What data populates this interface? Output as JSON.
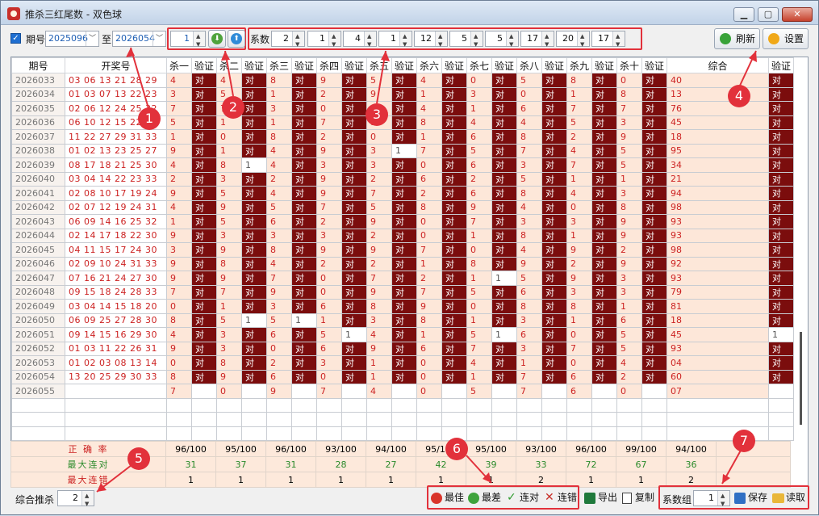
{
  "window": {
    "title": "推杀三红尾数 - 双色球"
  },
  "toolbar": {
    "period_label": "期号",
    "from_value": "2025096",
    "to_label": "至",
    "to_value": "2026054",
    "step_value": "1",
    "coef_label": "系数",
    "coefficients": [
      "2",
      "1",
      "4",
      "1",
      "12",
      "5",
      "5",
      "17",
      "20",
      "17"
    ],
    "refresh_label": "刷新",
    "settings_label": "设置"
  },
  "columns": [
    "期号",
    "开奖号",
    "杀一",
    "验证",
    "杀二",
    "验证",
    "杀三",
    "验证",
    "杀四",
    "验证",
    "杀五",
    "验证",
    "杀六",
    "验证",
    "杀七",
    "验证",
    "杀八",
    "验证",
    "杀九",
    "验证",
    "杀十",
    "验证",
    "综合",
    "验证"
  ],
  "rows": [
    {
      "period": "2026033",
      "numbers": "03 06 13 21 28 29",
      "kills": [
        "4",
        "4",
        "8",
        "9",
        "5",
        "4",
        "0",
        "5",
        "8",
        "0"
      ],
      "checks": [
        "对",
        "对",
        "对",
        "对",
        "对",
        "对",
        "对",
        "对",
        "对",
        "对"
      ],
      "combined": "40",
      "check": "对"
    },
    {
      "period": "2026034",
      "numbers": "01 03 07 13 22 23",
      "kills": [
        "3",
        "5",
        "1",
        "2",
        "9",
        "1",
        "3",
        "0",
        "1",
        "8"
      ],
      "checks": [
        "对",
        "对",
        "对",
        "对",
        "对",
        "对",
        "对",
        "对",
        "对",
        "对"
      ],
      "combined": "13",
      "check": "对"
    },
    {
      "period": "2026035",
      "numbers": "02 06 12 24 25 32",
      "kills": [
        "7",
        "7",
        "3",
        "0",
        "1",
        "4",
        "1",
        "6",
        "7",
        "7"
      ],
      "checks": [
        "对",
        "对",
        "对",
        "对",
        "对",
        "对",
        "对",
        "对",
        "对",
        "对"
      ],
      "combined": "76",
      "check": "对"
    },
    {
      "period": "2026036",
      "numbers": "06 10 12 15 22 30",
      "kills": [
        "5",
        "1",
        "1",
        "7",
        "1",
        "8",
        "4",
        "4",
        "5",
        "3"
      ],
      "checks": [
        "对",
        "对",
        "对",
        "对",
        "对",
        "对",
        "对",
        "对",
        "对",
        "对"
      ],
      "combined": "45",
      "check": "对"
    },
    {
      "period": "2026037",
      "numbers": "11 22 27 29 31 33",
      "kills": [
        "1",
        "0",
        "8",
        "2",
        "0",
        "1",
        "6",
        "8",
        "2",
        "9"
      ],
      "checks": [
        "对",
        "对",
        "对",
        "对",
        "对",
        "对",
        "对",
        "对",
        "对",
        "对"
      ],
      "combined": "18",
      "check": "对"
    },
    {
      "period": "2026038",
      "numbers": "01 02 13 23 25 27",
      "kills": [
        "9",
        "1",
        "4",
        "9",
        "3",
        "7",
        "5",
        "7",
        "4",
        "5"
      ],
      "checks": [
        "对",
        "对",
        "对",
        "对",
        "1",
        "对",
        "对",
        "对",
        "对",
        "对"
      ],
      "combined": "95",
      "check": "对"
    },
    {
      "period": "2026039",
      "numbers": "08 17 18 21 25 30",
      "kills": [
        "4",
        "8",
        "4",
        "3",
        "3",
        "0",
        "6",
        "3",
        "7",
        "5"
      ],
      "checks": [
        "对",
        "1",
        "对",
        "对",
        "对",
        "对",
        "对",
        "对",
        "对",
        "对"
      ],
      "combined": "34",
      "check": "对"
    },
    {
      "period": "2026040",
      "numbers": "03 04 14 22 23 33",
      "kills": [
        "2",
        "3",
        "2",
        "9",
        "2",
        "6",
        "2",
        "5",
        "1",
        "1"
      ],
      "checks": [
        "对",
        "对",
        "对",
        "对",
        "对",
        "对",
        "对",
        "对",
        "对",
        "对"
      ],
      "combined": "21",
      "check": "对"
    },
    {
      "period": "2026041",
      "numbers": "02 08 10 17 19 24",
      "kills": [
        "9",
        "5",
        "4",
        "9",
        "7",
        "2",
        "6",
        "8",
        "4",
        "3"
      ],
      "checks": [
        "对",
        "对",
        "对",
        "对",
        "对",
        "对",
        "对",
        "对",
        "对",
        "对"
      ],
      "combined": "94",
      "check": "对"
    },
    {
      "period": "2026042",
      "numbers": "02 07 12 19 24 31",
      "kills": [
        "4",
        "9",
        "5",
        "7",
        "5",
        "8",
        "9",
        "4",
        "0",
        "8"
      ],
      "checks": [
        "对",
        "对",
        "对",
        "对",
        "对",
        "对",
        "对",
        "对",
        "对",
        "对"
      ],
      "combined": "98",
      "check": "对"
    },
    {
      "period": "2026043",
      "numbers": "06 09 14 16 25 32",
      "kills": [
        "1",
        "5",
        "6",
        "2",
        "9",
        "0",
        "7",
        "3",
        "3",
        "9"
      ],
      "checks": [
        "对",
        "对",
        "对",
        "对",
        "对",
        "对",
        "对",
        "对",
        "对",
        "对"
      ],
      "combined": "93",
      "check": "对"
    },
    {
      "period": "2026044",
      "numbers": "02 14 17 18 22 30",
      "kills": [
        "9",
        "3",
        "3",
        "3",
        "2",
        "0",
        "1",
        "8",
        "1",
        "9"
      ],
      "checks": [
        "对",
        "对",
        "对",
        "对",
        "对",
        "对",
        "对",
        "对",
        "对",
        "对"
      ],
      "combined": "93",
      "check": "对"
    },
    {
      "period": "2026045",
      "numbers": "04 11 15 17 24 30",
      "kills": [
        "3",
        "9",
        "8",
        "9",
        "9",
        "7",
        "0",
        "4",
        "9",
        "2"
      ],
      "checks": [
        "对",
        "对",
        "对",
        "对",
        "对",
        "对",
        "对",
        "对",
        "对",
        "对"
      ],
      "combined": "98",
      "check": "对"
    },
    {
      "period": "2026046",
      "numbers": "02 09 10 24 31 33",
      "kills": [
        "9",
        "8",
        "4",
        "2",
        "2",
        "1",
        "8",
        "9",
        "2",
        "9"
      ],
      "checks": [
        "对",
        "对",
        "对",
        "对",
        "对",
        "对",
        "对",
        "对",
        "对",
        "对"
      ],
      "combined": "92",
      "check": "对"
    },
    {
      "period": "2026047",
      "numbers": "07 16 21 24 27 30",
      "kills": [
        "9",
        "9",
        "7",
        "0",
        "7",
        "2",
        "1",
        "5",
        "9",
        "3"
      ],
      "checks": [
        "对",
        "对",
        "对",
        "对",
        "对",
        "对",
        "1",
        "对",
        "对",
        "对"
      ],
      "combined": "93",
      "check": "对"
    },
    {
      "period": "2026048",
      "numbers": "09 15 18 24 28 33",
      "kills": [
        "7",
        "7",
        "9",
        "0",
        "9",
        "7",
        "5",
        "6",
        "3",
        "3"
      ],
      "checks": [
        "对",
        "对",
        "对",
        "对",
        "对",
        "对",
        "对",
        "对",
        "对",
        "对"
      ],
      "combined": "79",
      "check": "对"
    },
    {
      "period": "2026049",
      "numbers": "03 04 14 15 18 20",
      "kills": [
        "0",
        "1",
        "3",
        "6",
        "8",
        "9",
        "0",
        "8",
        "8",
        "1"
      ],
      "checks": [
        "对",
        "对",
        "对",
        "对",
        "对",
        "对",
        "对",
        "对",
        "对",
        "对"
      ],
      "combined": "81",
      "check": "对"
    },
    {
      "period": "2026050",
      "numbers": "06 09 25 27 28 30",
      "kills": [
        "8",
        "5",
        "5",
        "1",
        "3",
        "8",
        "1",
        "3",
        "1",
        "6"
      ],
      "checks": [
        "对",
        "1",
        "1",
        "对",
        "对",
        "对",
        "对",
        "对",
        "对",
        "对"
      ],
      "combined": "18",
      "check": "对"
    },
    {
      "period": "2026051",
      "numbers": "09 14 15 16 29 30",
      "kills": [
        "4",
        "3",
        "6",
        "5",
        "4",
        "1",
        "5",
        "6",
        "0",
        "5"
      ],
      "checks": [
        "对",
        "对",
        "对",
        "1",
        "对",
        "对",
        "1",
        "对",
        "对",
        "对"
      ],
      "combined": "45",
      "check": "1"
    },
    {
      "period": "2026052",
      "numbers": "01 03 11 22 26 31",
      "kills": [
        "9",
        "3",
        "0",
        "6",
        "9",
        "6",
        "7",
        "3",
        "7",
        "5"
      ],
      "checks": [
        "对",
        "对",
        "对",
        "对",
        "对",
        "对",
        "对",
        "对",
        "对",
        "对"
      ],
      "combined": "93",
      "check": "对"
    },
    {
      "period": "2026053",
      "numbers": "01 02 03 08 13 14",
      "kills": [
        "0",
        "8",
        "2",
        "3",
        "1",
        "0",
        "4",
        "1",
        "0",
        "4"
      ],
      "checks": [
        "对",
        "对",
        "对",
        "对",
        "对",
        "对",
        "对",
        "对",
        "对",
        "对"
      ],
      "combined": "04",
      "check": "对"
    },
    {
      "period": "2026054",
      "numbers": "13 20 25 29 30 33",
      "kills": [
        "8",
        "9",
        "6",
        "0",
        "1",
        "0",
        "1",
        "7",
        "6",
        "2"
      ],
      "checks": [
        "对",
        "对",
        "对",
        "对",
        "对",
        "对",
        "对",
        "对",
        "对",
        "对"
      ],
      "combined": "60",
      "check": "对"
    },
    {
      "period": "2026055",
      "numbers": "",
      "kills": [
        "7",
        "0",
        "9",
        "7",
        "4",
        "0",
        "5",
        "7",
        "6",
        "0"
      ],
      "checks": [
        "",
        "",
        "",
        "",
        "",
        "",
        "",
        "",
        "",
        ""
      ],
      "combined": "07",
      "check": ""
    }
  ],
  "stats": {
    "accuracy_label": "正 确 率",
    "max_streak_label": "最大连对",
    "max_error_label": "最大连错",
    "accuracy": [
      "96/100",
      "95/100",
      "96/100",
      "93/100",
      "94/100",
      "95/100",
      "95/100",
      "93/100",
      "96/100",
      "99/100",
      "94/100"
    ],
    "max_streak": [
      "31",
      "37",
      "31",
      "28",
      "27",
      "42",
      "39",
      "33",
      "72",
      "67",
      "36"
    ],
    "max_error": [
      "1",
      "1",
      "1",
      "1",
      "1",
      "1",
      "1",
      "2",
      "1",
      "1",
      "2"
    ]
  },
  "bottom": {
    "combined_label": "综合推杀",
    "combined_value": "2",
    "best_label": "最佳",
    "worst_label": "最差",
    "streak_label": "连对",
    "error_label": "连错",
    "export_label": "导出",
    "copy_label": "复制",
    "coef_group_label": "系数组",
    "coef_group_value": "1",
    "save_label": "保存",
    "load_label": "读取"
  },
  "callouts": [
    "1",
    "2",
    "3",
    "4",
    "5",
    "6",
    "7"
  ],
  "colors": {
    "accent_red": "#e2313b",
    "dark_red": "#7b0d0d",
    "number_red": "#cc2222",
    "peach": "#fde7d9",
    "green": "#2a8a2a"
  }
}
